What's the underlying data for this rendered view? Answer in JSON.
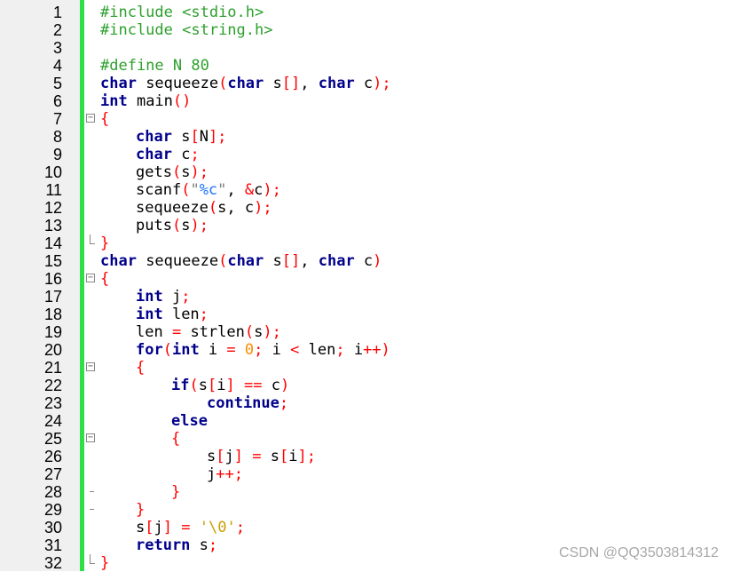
{
  "editor": {
    "lines": [
      {
        "n": "1",
        "indent": 0,
        "fold": "",
        "tokens": [
          [
            "pp",
            "#include "
          ],
          [
            "pp",
            "<stdio.h>"
          ]
        ]
      },
      {
        "n": "2",
        "indent": 0,
        "fold": "",
        "tokens": [
          [
            "pp",
            "#include "
          ],
          [
            "pp",
            "<string.h>"
          ]
        ]
      },
      {
        "n": "3",
        "indent": 0,
        "fold": "",
        "tokens": []
      },
      {
        "n": "4",
        "indent": 0,
        "fold": "",
        "tokens": [
          [
            "pp",
            "#define N 80"
          ]
        ]
      },
      {
        "n": "5",
        "indent": 0,
        "fold": "",
        "tokens": [
          [
            "kw",
            "char"
          ],
          [
            "tx",
            " sequeeze"
          ],
          [
            "op",
            "("
          ],
          [
            "kw",
            "char"
          ],
          [
            "tx",
            " s"
          ],
          [
            "op",
            "[]"
          ],
          [
            "tx",
            ", "
          ],
          [
            "kw",
            "char"
          ],
          [
            "tx",
            " c"
          ],
          [
            "op",
            ");"
          ]
        ]
      },
      {
        "n": "6",
        "indent": 0,
        "fold": "",
        "tokens": [
          [
            "kw",
            "int"
          ],
          [
            "tx",
            " main"
          ],
          [
            "op",
            "()"
          ]
        ]
      },
      {
        "n": "7",
        "indent": 0,
        "fold": "open",
        "tokens": [
          [
            "op",
            "{"
          ]
        ]
      },
      {
        "n": "8",
        "indent": 1,
        "fold": "line",
        "tokens": [
          [
            "kw",
            "char"
          ],
          [
            "tx",
            " s"
          ],
          [
            "op",
            "["
          ],
          [
            "tx",
            "N"
          ],
          [
            "op",
            "];"
          ]
        ]
      },
      {
        "n": "9",
        "indent": 1,
        "fold": "line",
        "tokens": [
          [
            "kw",
            "char"
          ],
          [
            "tx",
            " c"
          ],
          [
            "op",
            ";"
          ]
        ]
      },
      {
        "n": "10",
        "indent": 1,
        "fold": "line",
        "tokens": [
          [
            "tx",
            "gets"
          ],
          [
            "op",
            "("
          ],
          [
            "tx",
            "s"
          ],
          [
            "op",
            ");"
          ]
        ]
      },
      {
        "n": "11",
        "indent": 1,
        "fold": "line",
        "tokens": [
          [
            "tx",
            "scanf"
          ],
          [
            "op",
            "("
          ],
          [
            "str",
            "\""
          ],
          [
            "fmt",
            "%c"
          ],
          [
            "str",
            "\""
          ],
          [
            "tx",
            ", "
          ],
          [
            "op",
            "&"
          ],
          [
            "tx",
            "c"
          ],
          [
            "op",
            ");"
          ]
        ]
      },
      {
        "n": "12",
        "indent": 1,
        "fold": "line",
        "tokens": [
          [
            "tx",
            "sequeeze"
          ],
          [
            "op",
            "("
          ],
          [
            "tx",
            "s, c"
          ],
          [
            "op",
            ");"
          ]
        ]
      },
      {
        "n": "13",
        "indent": 1,
        "fold": "line",
        "tokens": [
          [
            "tx",
            "puts"
          ],
          [
            "op",
            "("
          ],
          [
            "tx",
            "s"
          ],
          [
            "op",
            ");"
          ]
        ]
      },
      {
        "n": "14",
        "indent": 0,
        "fold": "end",
        "tokens": [
          [
            "op",
            "}"
          ]
        ]
      },
      {
        "n": "15",
        "indent": 0,
        "fold": "",
        "tokens": [
          [
            "kw",
            "char"
          ],
          [
            "tx",
            " sequeeze"
          ],
          [
            "op",
            "("
          ],
          [
            "kw",
            "char"
          ],
          [
            "tx",
            " s"
          ],
          [
            "op",
            "[]"
          ],
          [
            "tx",
            ", "
          ],
          [
            "kw",
            "char"
          ],
          [
            "tx",
            " c"
          ],
          [
            "op",
            ")"
          ]
        ]
      },
      {
        "n": "16",
        "indent": 0,
        "fold": "open",
        "tokens": [
          [
            "op",
            "{"
          ]
        ]
      },
      {
        "n": "17",
        "indent": 1,
        "fold": "line",
        "tokens": [
          [
            "kw",
            "int"
          ],
          [
            "tx",
            " j"
          ],
          [
            "op",
            ";"
          ]
        ]
      },
      {
        "n": "18",
        "indent": 1,
        "fold": "line",
        "tokens": [
          [
            "kw",
            "int"
          ],
          [
            "tx",
            " len"
          ],
          [
            "op",
            ";"
          ]
        ]
      },
      {
        "n": "19",
        "indent": 1,
        "fold": "line",
        "tokens": [
          [
            "tx",
            "len "
          ],
          [
            "op",
            "="
          ],
          [
            "tx",
            " strlen"
          ],
          [
            "op",
            "("
          ],
          [
            "tx",
            "s"
          ],
          [
            "op",
            ");"
          ]
        ]
      },
      {
        "n": "20",
        "indent": 1,
        "fold": "line",
        "tokens": [
          [
            "kw",
            "for"
          ],
          [
            "op",
            "("
          ],
          [
            "kw",
            "int"
          ],
          [
            "tx",
            " i "
          ],
          [
            "op",
            "="
          ],
          [
            "tx",
            " "
          ],
          [
            "num",
            "0"
          ],
          [
            "op",
            ";"
          ],
          [
            "tx",
            " i "
          ],
          [
            "op",
            "<"
          ],
          [
            "tx",
            " len"
          ],
          [
            "op",
            ";"
          ],
          [
            "tx",
            " i"
          ],
          [
            "op",
            "++)"
          ]
        ]
      },
      {
        "n": "21",
        "indent": 1,
        "fold": "open",
        "tokens": [
          [
            "op",
            "{"
          ]
        ]
      },
      {
        "n": "22",
        "indent": 2,
        "fold": "line",
        "tokens": [
          [
            "kw",
            "if"
          ],
          [
            "op",
            "("
          ],
          [
            "tx",
            "s"
          ],
          [
            "op",
            "["
          ],
          [
            "tx",
            "i"
          ],
          [
            "op",
            "]"
          ],
          [
            "tx",
            " "
          ],
          [
            "op",
            "=="
          ],
          [
            "tx",
            " c"
          ],
          [
            "op",
            ")"
          ]
        ]
      },
      {
        "n": "23",
        "indent": 3,
        "fold": "line",
        "tokens": [
          [
            "kw",
            "continue"
          ],
          [
            "op",
            ";"
          ]
        ]
      },
      {
        "n": "24",
        "indent": 2,
        "fold": "line",
        "tokens": [
          [
            "kw",
            "else"
          ]
        ]
      },
      {
        "n": "25",
        "indent": 2,
        "fold": "open",
        "tokens": [
          [
            "op",
            "{"
          ]
        ]
      },
      {
        "n": "26",
        "indent": 3,
        "fold": "line",
        "tokens": [
          [
            "tx",
            "s"
          ],
          [
            "op",
            "["
          ],
          [
            "tx",
            "j"
          ],
          [
            "op",
            "]"
          ],
          [
            "tx",
            " "
          ],
          [
            "op",
            "="
          ],
          [
            "tx",
            " s"
          ],
          [
            "op",
            "["
          ],
          [
            "tx",
            "i"
          ],
          [
            "op",
            "];"
          ]
        ]
      },
      {
        "n": "27",
        "indent": 3,
        "fold": "line",
        "tokens": [
          [
            "tx",
            "j"
          ],
          [
            "op",
            "++;"
          ]
        ]
      },
      {
        "n": "28",
        "indent": 2,
        "fold": "dash",
        "tokens": [
          [
            "op",
            "}"
          ]
        ]
      },
      {
        "n": "29",
        "indent": 1,
        "fold": "dash",
        "tokens": [
          [
            "op",
            "}"
          ]
        ]
      },
      {
        "n": "30",
        "indent": 1,
        "fold": "line",
        "tokens": [
          [
            "tx",
            "s"
          ],
          [
            "op",
            "["
          ],
          [
            "tx",
            "j"
          ],
          [
            "op",
            "]"
          ],
          [
            "tx",
            " "
          ],
          [
            "op",
            "="
          ],
          [
            "tx",
            " "
          ],
          [
            "esc",
            "'\\0'"
          ],
          [
            "op",
            ";"
          ]
        ]
      },
      {
        "n": "31",
        "indent": 1,
        "fold": "line",
        "tokens": [
          [
            "kw",
            "return"
          ],
          [
            "tx",
            " s"
          ],
          [
            "op",
            ";"
          ]
        ]
      },
      {
        "n": "32",
        "indent": 0,
        "fold": "end",
        "tokens": [
          [
            "op",
            "}"
          ]
        ]
      }
    ]
  },
  "watermark": "CSDN @QQ3503814312",
  "colors": {
    "gutter_bg": "#f0f0f0",
    "change_bar": "#2ee044",
    "keyword": "#00008b",
    "preprocessor": "#2ca02c",
    "operator": "#ff0000",
    "number": "#ff8c00"
  }
}
